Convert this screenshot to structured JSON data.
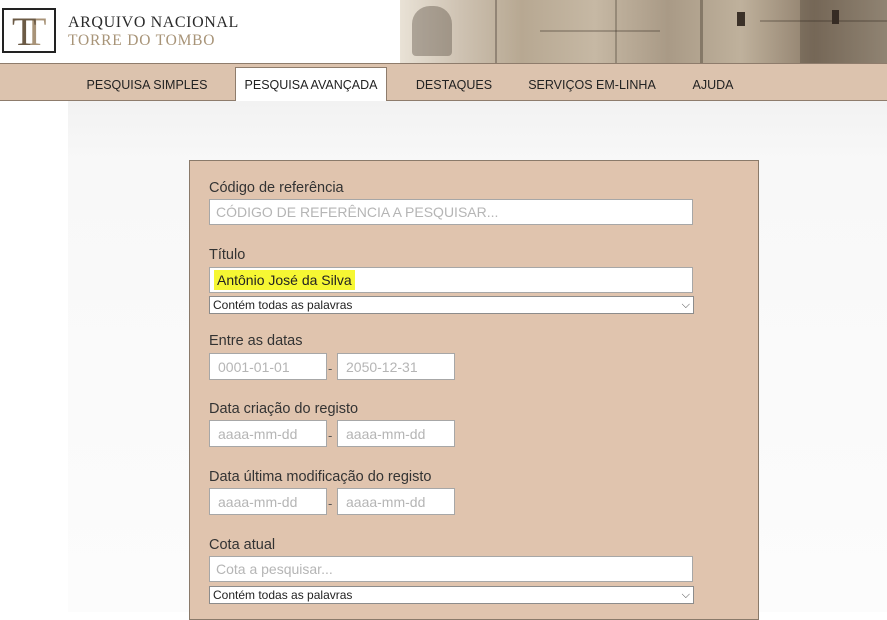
{
  "header": {
    "logo_line1": "ARQUIVO NACIONAL",
    "logo_line2": "TORRE DO TOMBO",
    "logo_monogram": "T"
  },
  "nav": {
    "tabs": [
      {
        "label": "PESQUISA SIMPLES",
        "active": false
      },
      {
        "label": "PESQUISA AVANÇADA",
        "active": true
      },
      {
        "label": "DESTAQUES",
        "active": false
      },
      {
        "label": "SERVIÇOS EM-LINHA",
        "active": false
      },
      {
        "label": "AJUDA",
        "active": false
      }
    ]
  },
  "form": {
    "ref_code": {
      "label": "Código de referência",
      "placeholder": "CÓDIGO DE REFERÊNCIA A PESQUISAR...",
      "value": ""
    },
    "title": {
      "label": "Título",
      "value": "Antônio José da Silva",
      "match_option": "Contém todas as palavras"
    },
    "date_range": {
      "label": "Entre as datas",
      "from_placeholder": "0001-01-01",
      "to_placeholder": "2050-12-31",
      "separator": "-"
    },
    "created": {
      "label": "Data criação do registo",
      "from_placeholder": "aaaa-mm-dd",
      "to_placeholder": "aaaa-mm-dd",
      "separator": "-"
    },
    "modified": {
      "label": "Data última modificação do registo",
      "from_placeholder": "aaaa-mm-dd",
      "to_placeholder": "aaaa-mm-dd",
      "separator": "-"
    },
    "shelfmark": {
      "label": "Cota atual",
      "placeholder": "Cota a pesquisar...",
      "match_option": "Contém todas as palavras"
    }
  },
  "colors": {
    "nav_bg": "#dcc3ae",
    "panel_bg": "#e0c4ae",
    "highlight": "#f6f733"
  }
}
